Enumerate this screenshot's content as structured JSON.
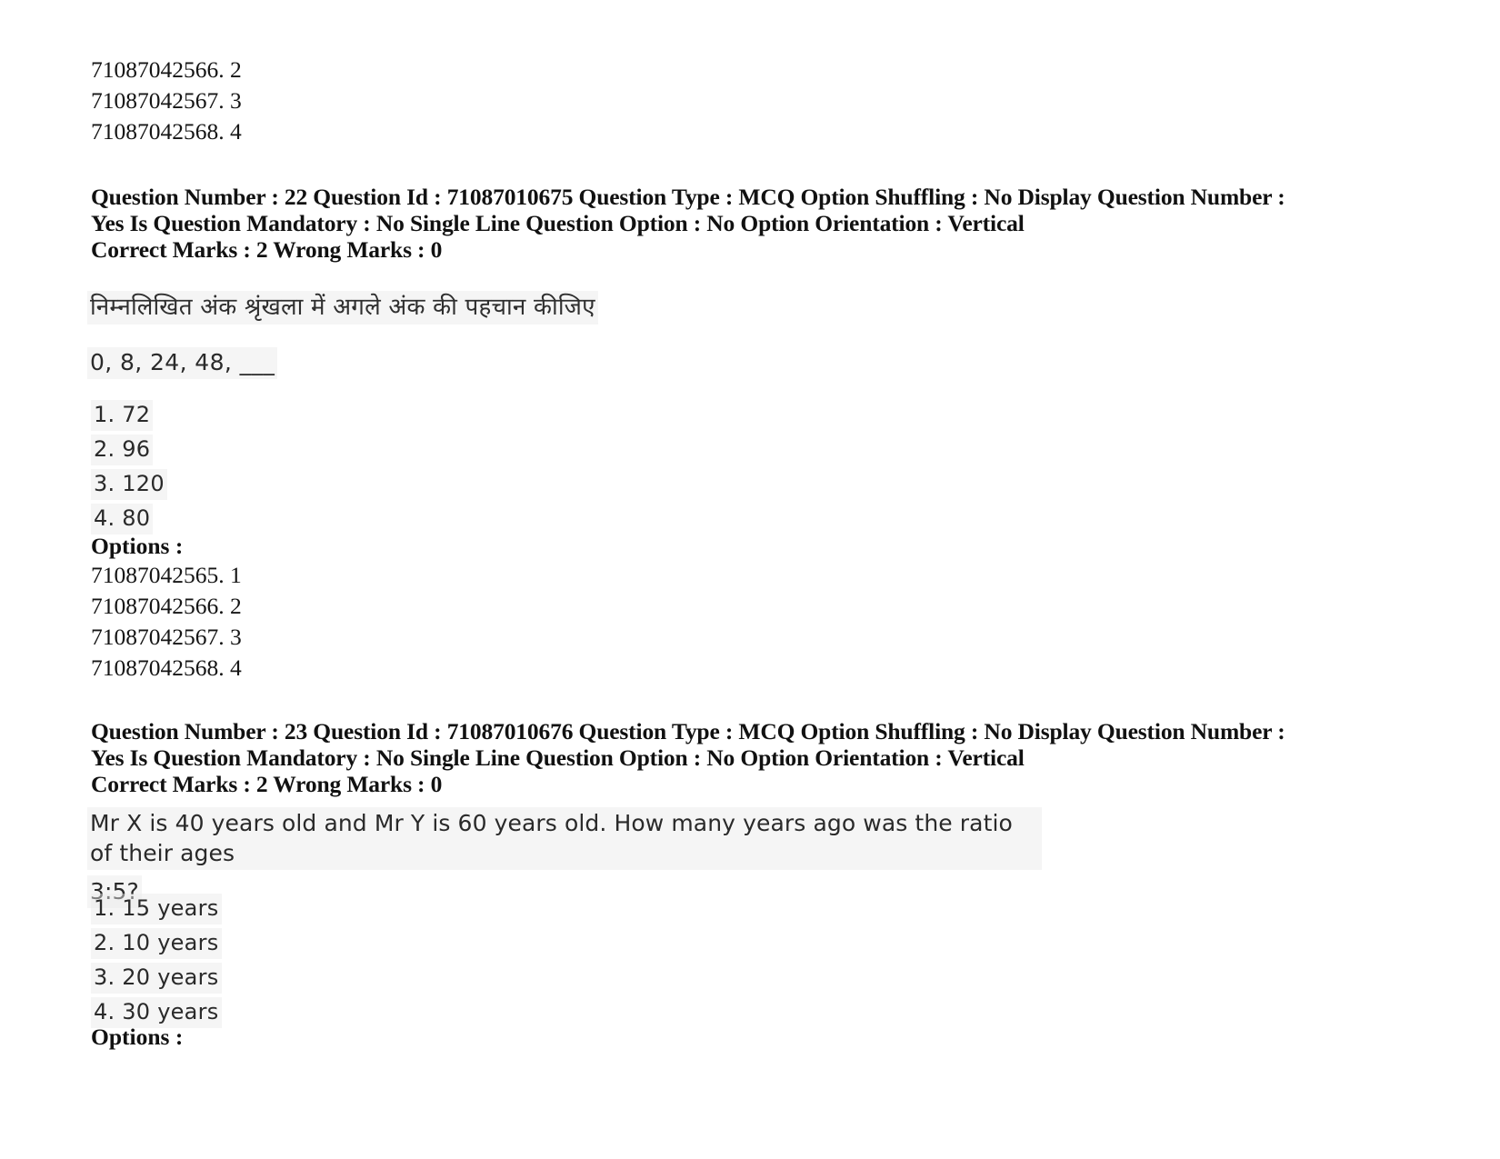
{
  "document": {
    "type": "exam-question-paper",
    "background_color": "#ffffff",
    "text_color": "#000000"
  },
  "top_option_ids": [
    "71087042566. 2",
    "71087042567. 3",
    "71087042568. 4"
  ],
  "questions": [
    {
      "meta_line": "Question Number : 22 Question Id : 71087010675 Question Type : MCQ Option Shuffling : No Display Question Number : Yes Is Question Mandatory : No Single Line Question Option : No Option Orientation : Vertical",
      "marks_line": "Correct Marks : 2 Wrong Marks : 0",
      "question_number": "22",
      "question_id": "71087010675",
      "question_type": "MCQ",
      "option_shuffling": "No",
      "display_question_number": "Yes",
      "is_question_mandatory": "No",
      "single_line_question_option": "No",
      "option_orientation": "Vertical",
      "correct_marks": "2",
      "wrong_marks": "0",
      "stem_hindi": "निम्नलिखित अंक श्रृंखला में अगले अंक की पहचान कीजिए",
      "stem_series": "0, 8, 24, 48, ___",
      "choices": [
        "1. 72",
        "2. 96",
        "3. 120",
        "4. 80"
      ],
      "options_label": "Options :",
      "option_ids": [
        "71087042565. 1",
        "71087042566. 2",
        "71087042567. 3",
        "71087042568. 4"
      ]
    },
    {
      "meta_line": "Question Number : 23 Question Id : 71087010676 Question Type : MCQ Option Shuffling : No Display Question Number : Yes Is Question Mandatory : No Single Line Question Option : No Option Orientation : Vertical",
      "marks_line": "Correct Marks : 2 Wrong Marks : 0",
      "question_number": "23",
      "question_id": "71087010676",
      "question_type": "MCQ",
      "option_shuffling": "No",
      "display_question_number": "Yes",
      "is_question_mandatory": "No",
      "single_line_question_option": "No",
      "option_orientation": "Vertical",
      "correct_marks": "2",
      "wrong_marks": "0",
      "stem_line1": "Mr X is 40 years old and Mr Y is 60 years old. How many years ago was the ratio of their ages",
      "stem_line2": "3:5?",
      "choices": [
        "1. 15 years",
        "2. 10 years",
        "3. 20 years",
        "4. 30 years"
      ],
      "options_label": "Options :"
    }
  ]
}
